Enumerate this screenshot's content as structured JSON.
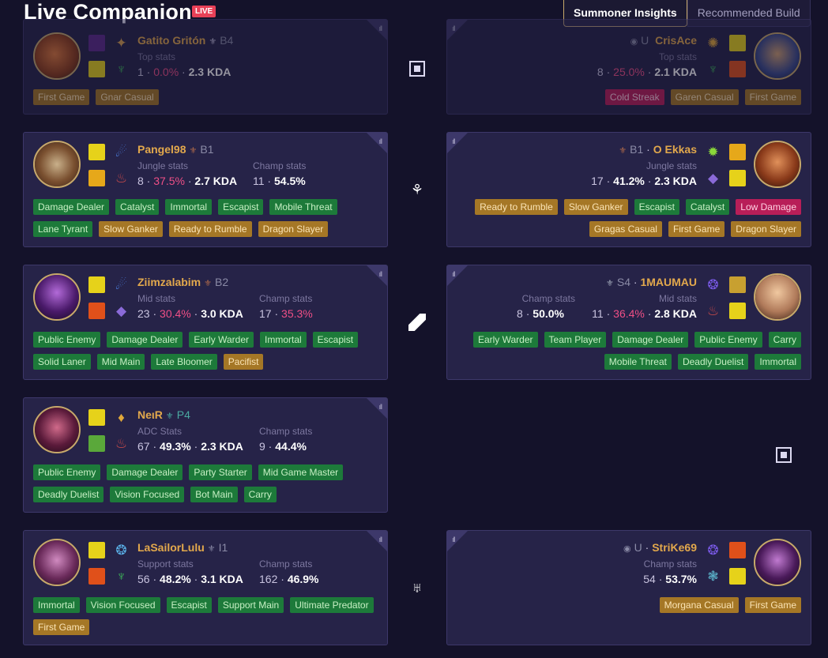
{
  "header": {
    "title": "Live Companion",
    "live_badge": "LIVE"
  },
  "tabs": [
    {
      "label": "Summoner Insights"
    },
    {
      "label": "Recommended Build"
    }
  ],
  "left_team": [
    {
      "name": "Gatito Gritón",
      "rank": "B4",
      "stat1_label": "Top stats",
      "stat1_games": "1",
      "stat1_wr": "0.0%",
      "stat1_kda": "2.3 KDA",
      "stat2_label": "",
      "stat2_games": "",
      "stat2_wr": "",
      "tags": [
        {
          "label": "First Game",
          "color": "gold"
        },
        {
          "label": "Gnar Casual",
          "color": "gold"
        }
      ]
    },
    {
      "name": "Pangel98",
      "rank": "B1",
      "stat1_label": "Jungle stats",
      "stat1_games": "8",
      "stat1_wr": "37.5%",
      "stat1_kda": "2.7 KDA",
      "stat2_label": "Champ stats",
      "stat2_games": "11",
      "stat2_wr": "54.5%",
      "tags": [
        {
          "label": "Damage Dealer",
          "color": "green"
        },
        {
          "label": "Catalyst",
          "color": "green"
        },
        {
          "label": "Immortal",
          "color": "green"
        },
        {
          "label": "Escapist",
          "color": "green"
        },
        {
          "label": "Mobile Threat",
          "color": "green"
        },
        {
          "label": "Lane Tyrant",
          "color": "green"
        },
        {
          "label": "Slow Ganker",
          "color": "gold"
        },
        {
          "label": "Ready to Rumble",
          "color": "gold"
        },
        {
          "label": "Dragon Slayer",
          "color": "gold"
        }
      ]
    },
    {
      "name": "Ziimzalabim",
      "rank": "B2",
      "stat1_label": "Mid stats",
      "stat1_games": "23",
      "stat1_wr": "30.4%",
      "stat1_kda": "3.0 KDA",
      "stat2_label": "Champ stats",
      "stat2_games": "17",
      "stat2_wr": "35.3%",
      "tags": [
        {
          "label": "Public Enemy",
          "color": "green"
        },
        {
          "label": "Damage Dealer",
          "color": "green"
        },
        {
          "label": "Early Warder",
          "color": "green"
        },
        {
          "label": "Immortal",
          "color": "green"
        },
        {
          "label": "Escapist",
          "color": "green"
        },
        {
          "label": "Solid Laner",
          "color": "green"
        },
        {
          "label": "Mid Main",
          "color": "green"
        },
        {
          "label": "Late Bloomer",
          "color": "green"
        },
        {
          "label": "Pacifist",
          "color": "gold"
        }
      ]
    },
    {
      "name": "NeιR",
      "rank": "P4",
      "stat1_label": "ADC Stats",
      "stat1_games": "67",
      "stat1_wr": "49.3%",
      "stat1_kda": "2.3 KDA",
      "stat2_label": "Champ stats",
      "stat2_games": "9",
      "stat2_wr": "44.4%",
      "tags": [
        {
          "label": "Public Enemy",
          "color": "green"
        },
        {
          "label": "Damage Dealer",
          "color": "green"
        },
        {
          "label": "Party Starter",
          "color": "green"
        },
        {
          "label": "Mid Game Master",
          "color": "green"
        },
        {
          "label": "Deadly Duelist",
          "color": "green"
        },
        {
          "label": "Vision Focused",
          "color": "green"
        },
        {
          "label": "Bot Main",
          "color": "green"
        },
        {
          "label": "Carry",
          "color": "green"
        }
      ]
    },
    {
      "name": "LaSailorLulu",
      "rank": "I1",
      "stat1_label": "Support stats",
      "stat1_games": "56",
      "stat1_wr": "48.2%",
      "stat1_kda": "3.1 KDA",
      "stat2_label": "Champ stats",
      "stat2_games": "162",
      "stat2_wr": "46.9%",
      "tags": [
        {
          "label": "Immortal",
          "color": "green"
        },
        {
          "label": "Vision Focused",
          "color": "green"
        },
        {
          "label": "Escapist",
          "color": "green"
        },
        {
          "label": "Support Main",
          "color": "green"
        },
        {
          "label": "Ultimate Predator",
          "color": "green"
        },
        {
          "label": "First Game",
          "color": "gold"
        }
      ]
    }
  ],
  "right_team": [
    {
      "name": "CrisAce",
      "rank": "U",
      "stat1_label": "Top stats",
      "stat1_games": "8",
      "stat1_wr": "25.0%",
      "stat1_kda": "2.1 KDA",
      "stat2_label": "",
      "stat2_games": "",
      "stat2_wr": "",
      "tags": [
        {
          "label": "Cold Streak",
          "color": "pink"
        },
        {
          "label": "Garen Casual",
          "color": "gold"
        },
        {
          "label": "First Game",
          "color": "gold"
        }
      ]
    },
    {
      "name": "O Ekkas",
      "rank": "B1",
      "stat1_label": "Jungle stats",
      "stat1_games": "17",
      "stat1_wr": "41.2%",
      "stat1_kda": "2.3 KDA",
      "stat2_label": "",
      "stat2_games": "",
      "stat2_wr": "",
      "tags": [
        {
          "label": "Ready to Rumble",
          "color": "gold"
        },
        {
          "label": "Slow Ganker",
          "color": "gold"
        },
        {
          "label": "Escapist",
          "color": "green"
        },
        {
          "label": "Catalyst",
          "color": "green"
        },
        {
          "label": "Low Damage",
          "color": "pink"
        },
        {
          "label": "Gragas Casual",
          "color": "gold"
        },
        {
          "label": "First Game",
          "color": "gold"
        },
        {
          "label": "Dragon Slayer",
          "color": "gold"
        }
      ]
    },
    {
      "name": "1MAUMAU",
      "rank": "S4",
      "stat1_label": "Mid stats",
      "stat1_games": "11",
      "stat1_wr": "36.4%",
      "stat1_kda": "2.8 KDA",
      "stat2_label": "Champ stats",
      "stat2_games": "8",
      "stat2_wr": "50.0%",
      "tags": [
        {
          "label": "Early Warder",
          "color": "green"
        },
        {
          "label": "Team Player",
          "color": "green"
        },
        {
          "label": "Damage Dealer",
          "color": "green"
        },
        {
          "label": "Public Enemy",
          "color": "green"
        },
        {
          "label": "Carry",
          "color": "green"
        },
        {
          "label": "Mobile Threat",
          "color": "green"
        },
        {
          "label": "Deadly Duelist",
          "color": "green"
        },
        {
          "label": "Immortal",
          "color": "green"
        }
      ]
    },
    {
      "name": "StriKe69",
      "rank": "U",
      "stat1_label": "Champ stats",
      "stat1_games": "54",
      "stat1_wr": "53.7%",
      "stat1_kda": "",
      "stat2_label": "",
      "stat2_games": "",
      "stat2_wr": "",
      "tags": [
        {
          "label": "Morgana Casual",
          "color": "gold"
        },
        {
          "label": "First Game",
          "color": "gold"
        }
      ]
    }
  ],
  "colors": {
    "gold": "#c8a96a",
    "pink_stat": "#ef4f86",
    "background": "#14122a",
    "card": "#262348"
  },
  "icons": {
    "stats": "bar-stats-icon",
    "top_lane": "square-lane-icon",
    "jungle": "claw-jungle-icon",
    "mid_lane": "diagonal-lane-icon",
    "bot_lane": "square-lane-icon",
    "support": "wing-support-icon"
  }
}
